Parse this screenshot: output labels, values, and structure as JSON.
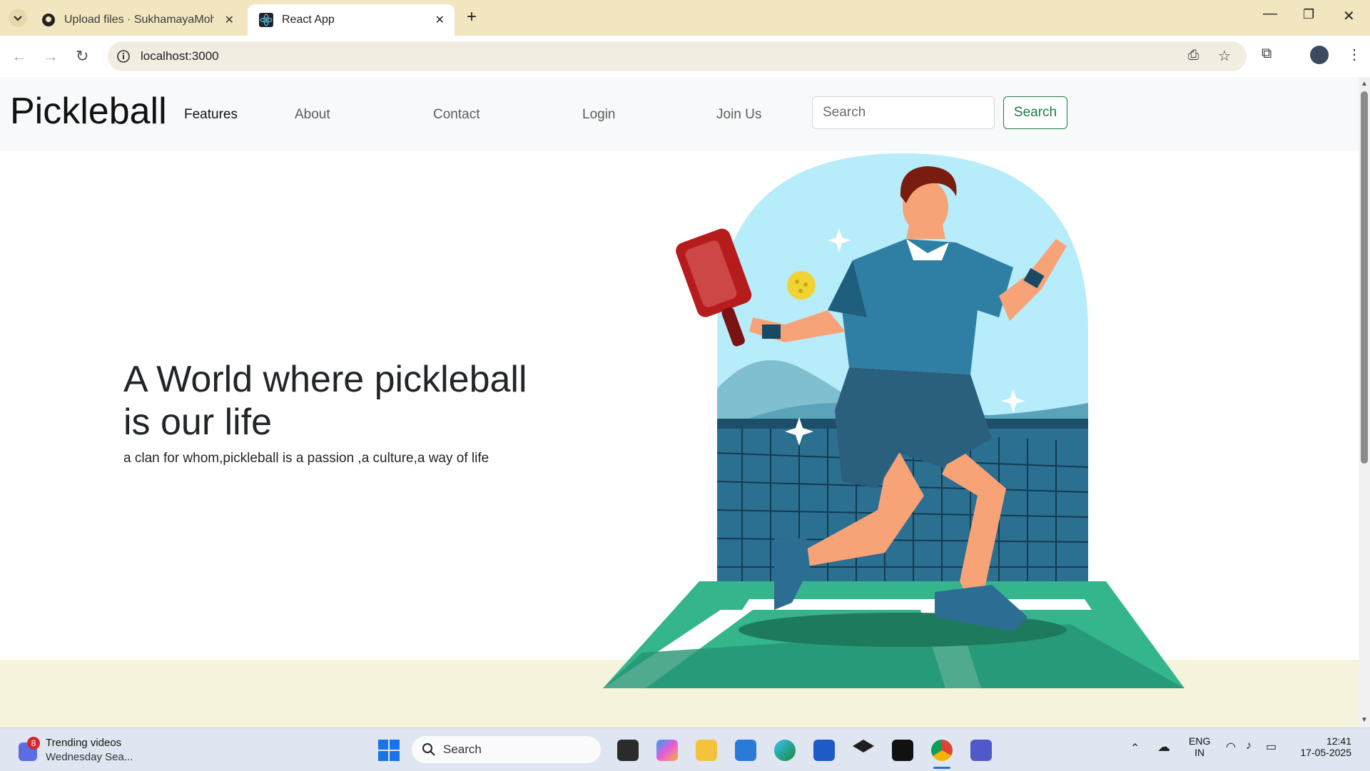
{
  "browser": {
    "tabs": [
      {
        "title": "Upload files · SukhamayaMohapatra",
        "icon": "github-icon"
      },
      {
        "title": "React App",
        "icon": "react-icon",
        "active": true
      }
    ],
    "url": "localhost:3000"
  },
  "navbar": {
    "brand": "Pickleball",
    "links": [
      "Features",
      "About",
      "Contact",
      "Login",
      "Join Us"
    ],
    "search_placeholder": "Search",
    "search_button": "Search"
  },
  "hero": {
    "title": "A World where pickleball is our life",
    "subtitle": "a clan for whom,pickleball is a passion ,a culture,a way of life"
  },
  "taskbar": {
    "notification_count": "8",
    "widget_title": "Trending videos",
    "widget_sub": "Wednesday Sea...",
    "search_label": "Search",
    "language": "ENG",
    "region": "IN",
    "time": "12:41",
    "date": "17-05-2025"
  },
  "colors": {
    "accent": "#1f7a4a",
    "tabbar": "#f1e6bf",
    "footer_band": "#f6f3dc"
  }
}
